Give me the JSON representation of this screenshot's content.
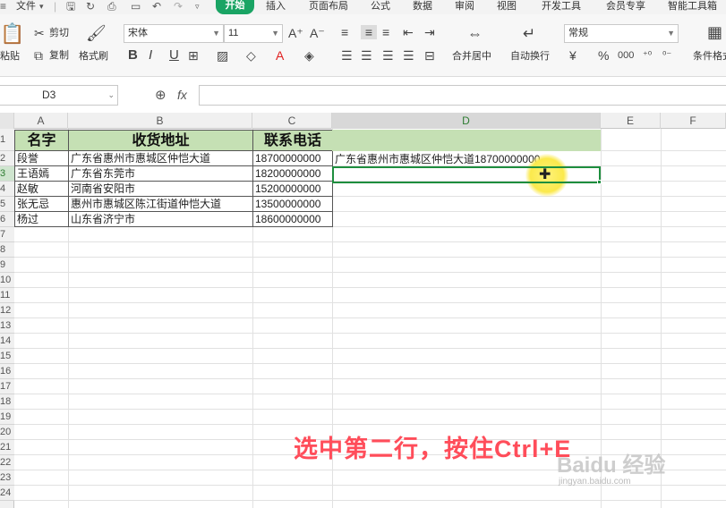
{
  "menubar": {
    "file": "文件",
    "tabs": [
      "开始",
      "插入",
      "页面布局",
      "公式",
      "数据",
      "审阅",
      "视图",
      "开发工具",
      "会员专享",
      "智能工具箱"
    ]
  },
  "ribbon": {
    "paste": "粘贴",
    "cut": "剪切",
    "copy": "复制",
    "format_painter": "格式刷",
    "font_name": "宋体",
    "font_size": "11",
    "bold": "B",
    "italic": "I",
    "underline": "U",
    "merge_center": "合并居中",
    "wrap_text": "自动换行",
    "number_format": "常规",
    "currency": "¥",
    "percent": "%",
    "thousands": "000",
    "conditional_format": "条件格式"
  },
  "formula_bar": {
    "name_box": "D3",
    "fx": "fx",
    "formula": ""
  },
  "columns": [
    "A",
    "B",
    "C",
    "D",
    "E",
    "F"
  ],
  "rows": [
    "1",
    "2",
    "3",
    "4",
    "5",
    "6",
    "7",
    "8",
    "9",
    "10",
    "11",
    "12",
    "13",
    "14",
    "15",
    "16",
    "17",
    "18",
    "19",
    "20",
    "21",
    "22",
    "23",
    "24"
  ],
  "sheet": {
    "headers": [
      "名字",
      "收货地址",
      "联系电话"
    ],
    "records": [
      {
        "name": "段誉",
        "address": "广东省惠州市惠城区仲恺大道",
        "phone": "18700000000"
      },
      {
        "name": "王语嫣",
        "address": "广东省东莞市",
        "phone": "18200000000"
      },
      {
        "name": "赵敏",
        "address": "河南省安阳市",
        "phone": "15200000000"
      },
      {
        "name": "张无忌",
        "address": "惠州市惠城区陈江街道仲恺大道",
        "phone": "13500000000"
      },
      {
        "name": "杨过",
        "address": "山东省济宁市",
        "phone": "18600000000"
      }
    ],
    "d2": "广东省惠州市惠城区仲恺大道18700000000"
  },
  "caption": "选中第二行，按住Ctrl+E",
  "watermark": "Baidu 经验",
  "watermark_url": "jingyan.baidu.com",
  "colors": {
    "accent": "#1aa464",
    "header_fill": "#c5e0b4",
    "selection": "#1e8e3e",
    "caption": "#ff4d5a"
  }
}
